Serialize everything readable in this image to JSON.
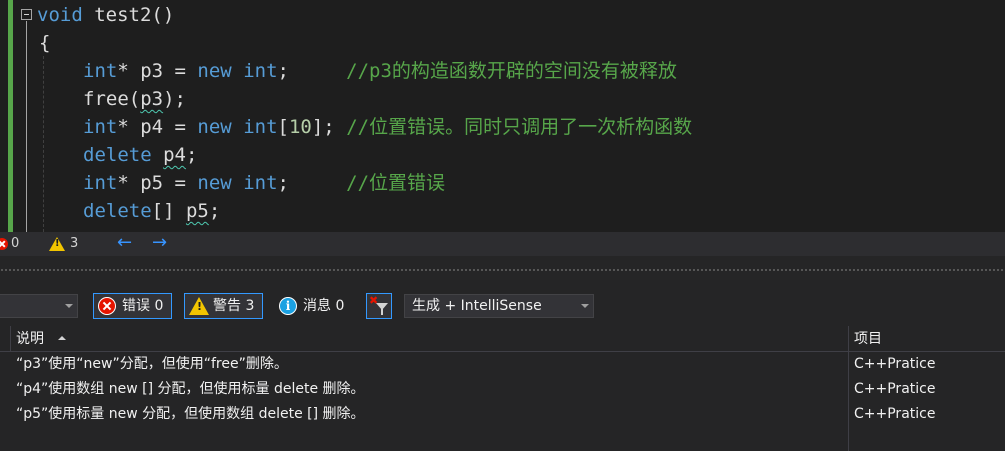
{
  "editor": {
    "lines": [
      {
        "tokens": [
          {
            "cls": "kw",
            "text": "void"
          },
          {
            "cls": "txt",
            "text": " test2()"
          }
        ]
      },
      {
        "tokens": [
          {
            "cls": "txt",
            "text": "{"
          }
        ]
      },
      {
        "tokens": [
          {
            "cls": "kw",
            "text": "int"
          },
          {
            "cls": "txt",
            "text": "* p3 = "
          },
          {
            "cls": "kw",
            "text": "new"
          },
          {
            "cls": "txt",
            "text": " "
          },
          {
            "cls": "kw",
            "text": "int"
          },
          {
            "cls": "txt",
            "text": ";     "
          },
          {
            "cls": "cm",
            "text": "//p3的构造函数开辟的空间没有被释放"
          }
        ]
      },
      {
        "tokens": [
          {
            "cls": "txt",
            "text": "free("
          },
          {
            "cls": "txt sq",
            "text": "p3"
          },
          {
            "cls": "txt",
            "text": ");"
          }
        ]
      },
      {
        "tokens": [
          {
            "cls": "kw",
            "text": "int"
          },
          {
            "cls": "txt",
            "text": "* p4 = "
          },
          {
            "cls": "kw",
            "text": "new"
          },
          {
            "cls": "txt",
            "text": " "
          },
          {
            "cls": "kw",
            "text": "int"
          },
          {
            "cls": "txt",
            "text": "["
          },
          {
            "cls": "num",
            "text": "10"
          },
          {
            "cls": "txt",
            "text": "]; "
          },
          {
            "cls": "cm",
            "text": "//位置错误。同时只调用了一次析构函数"
          }
        ]
      },
      {
        "tokens": [
          {
            "cls": "kw",
            "text": "delete"
          },
          {
            "cls": "txt",
            "text": " "
          },
          {
            "cls": "txt sq",
            "text": "p4"
          },
          {
            "cls": "txt",
            "text": ";"
          }
        ]
      },
      {
        "tokens": [
          {
            "cls": "kw",
            "text": "int"
          },
          {
            "cls": "txt",
            "text": "* p5 = "
          },
          {
            "cls": "kw",
            "text": "new"
          },
          {
            "cls": "txt",
            "text": " "
          },
          {
            "cls": "kw",
            "text": "int"
          },
          {
            "cls": "txt",
            "text": ";     "
          },
          {
            "cls": "cm",
            "text": "//位置错误"
          }
        ]
      },
      {
        "tokens": [
          {
            "cls": "kw",
            "text": "delete"
          },
          {
            "cls": "txt",
            "text": "[] "
          },
          {
            "cls": "txt sq",
            "text": "p5"
          },
          {
            "cls": "txt",
            "text": ";"
          }
        ]
      }
    ]
  },
  "editor_status": {
    "error_count": "0",
    "warning_count": "3",
    "nav_back": "←",
    "nav_forward": "→"
  },
  "error_list": {
    "errors_btn": "错误 0",
    "warnings_btn": "警告 3",
    "messages_btn": "消息 0",
    "info_glyph": "i",
    "clear_filter_glyph": "✖",
    "build_filter": "生成 + IntelliSense",
    "columns": {
      "description": "说明",
      "project": "项目"
    },
    "rows": [
      {
        "description": "“p3”使用“new”分配，但使用“free”删除。",
        "project": "C++Pratice"
      },
      {
        "description": "“p4”使用数组 new [] 分配，但使用标量 delete 删除。",
        "project": "C++Pratice"
      },
      {
        "description": "“p5”使用标量 new 分配，但使用数组 delete [] 删除。",
        "project": "C++Pratice"
      }
    ]
  },
  "colors": {
    "keyword": "#569cd6",
    "comment": "#57a64a",
    "number": "#b5cea8",
    "text": "#dcdcdc",
    "error": "#e51400",
    "warning": "#f2c500",
    "accent": "#3399ff"
  }
}
